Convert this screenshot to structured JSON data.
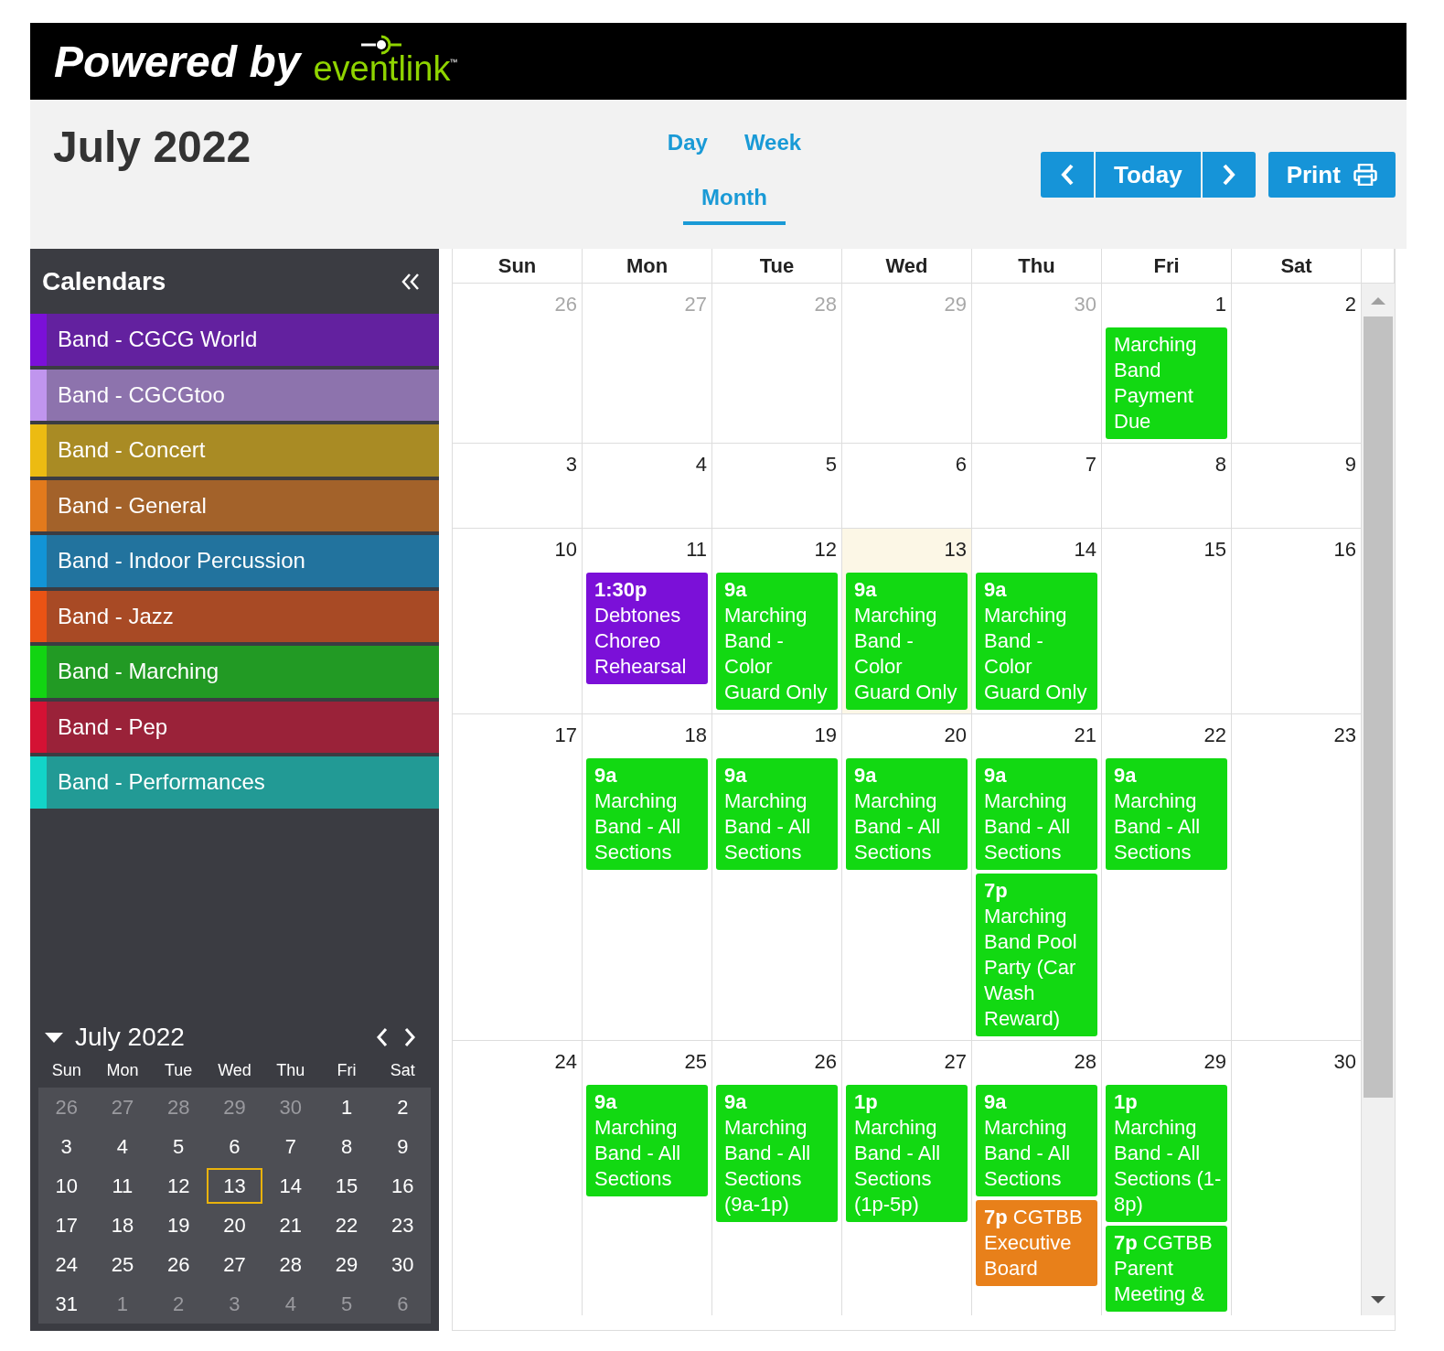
{
  "brand": {
    "prefix": "Powered by",
    "name": "eventlink",
    "trademark": "™"
  },
  "toolbar": {
    "title": "July 2022",
    "views": [
      {
        "label": "Day",
        "selected": false
      },
      {
        "label": "Week",
        "selected": false
      },
      {
        "label": "Month",
        "selected": true
      }
    ],
    "today_button": "Today",
    "print_button": "Print"
  },
  "sidebar": {
    "title": "Calendars",
    "calendars": [
      {
        "label": "Band - CGCG World",
        "color": "#7b10d8"
      },
      {
        "label": "Band - CGCGtoo",
        "color": "#c095ee"
      },
      {
        "label": "Band - Concert",
        "color": "#ecbb12"
      },
      {
        "label": "Band - General",
        "color": "#e27a1c"
      },
      {
        "label": "Band - Indoor Percussion",
        "color": "#1294d6"
      },
      {
        "label": "Band - Jazz",
        "color": "#ea5314"
      },
      {
        "label": "Band - Marching",
        "color": "#12d412"
      },
      {
        "label": "Band - Pep",
        "color": "#d41234"
      },
      {
        "label": "Band - Performances",
        "color": "#12d4c8"
      }
    ],
    "mini_calendar": {
      "title": "July 2022",
      "expanded": true,
      "weekdays": [
        "Sun",
        "Mon",
        "Tue",
        "Wed",
        "Thu",
        "Fri",
        "Sat"
      ],
      "weeks": [
        [
          {
            "day": "26",
            "other_month": true,
            "today": false
          },
          {
            "day": "27",
            "other_month": true,
            "today": false
          },
          {
            "day": "28",
            "other_month": true,
            "today": false
          },
          {
            "day": "29",
            "other_month": true,
            "today": false
          },
          {
            "day": "30",
            "other_month": true,
            "today": false
          },
          {
            "day": "1",
            "other_month": false,
            "today": false
          },
          {
            "day": "2",
            "other_month": false,
            "today": false
          }
        ],
        [
          {
            "day": "3",
            "other_month": false,
            "today": false
          },
          {
            "day": "4",
            "other_month": false,
            "today": false
          },
          {
            "day": "5",
            "other_month": false,
            "today": false
          },
          {
            "day": "6",
            "other_month": false,
            "today": false
          },
          {
            "day": "7",
            "other_month": false,
            "today": false
          },
          {
            "day": "8",
            "other_month": false,
            "today": false
          },
          {
            "day": "9",
            "other_month": false,
            "today": false
          }
        ],
        [
          {
            "day": "10",
            "other_month": false,
            "today": false
          },
          {
            "day": "11",
            "other_month": false,
            "today": false
          },
          {
            "day": "12",
            "other_month": false,
            "today": false
          },
          {
            "day": "13",
            "other_month": false,
            "today": true
          },
          {
            "day": "14",
            "other_month": false,
            "today": false
          },
          {
            "day": "15",
            "other_month": false,
            "today": false
          },
          {
            "day": "16",
            "other_month": false,
            "today": false
          }
        ],
        [
          {
            "day": "17",
            "other_month": false,
            "today": false
          },
          {
            "day": "18",
            "other_month": false,
            "today": false
          },
          {
            "day": "19",
            "other_month": false,
            "today": false
          },
          {
            "day": "20",
            "other_month": false,
            "today": false
          },
          {
            "day": "21",
            "other_month": false,
            "today": false
          },
          {
            "day": "22",
            "other_month": false,
            "today": false
          },
          {
            "day": "23",
            "other_month": false,
            "today": false
          }
        ],
        [
          {
            "day": "24",
            "other_month": false,
            "today": false
          },
          {
            "day": "25",
            "other_month": false,
            "today": false
          },
          {
            "day": "26",
            "other_month": false,
            "today": false
          },
          {
            "day": "27",
            "other_month": false,
            "today": false
          },
          {
            "day": "28",
            "other_month": false,
            "today": false
          },
          {
            "day": "29",
            "other_month": false,
            "today": false
          },
          {
            "day": "30",
            "other_month": false,
            "today": false
          }
        ],
        [
          {
            "day": "31",
            "other_month": false,
            "today": false
          },
          {
            "day": "1",
            "other_month": true,
            "today": false
          },
          {
            "day": "2",
            "other_month": true,
            "today": false
          },
          {
            "day": "3",
            "other_month": true,
            "today": false
          },
          {
            "day": "4",
            "other_month": true,
            "today": false
          },
          {
            "day": "5",
            "other_month": true,
            "today": false
          },
          {
            "day": "6",
            "other_month": true,
            "today": false
          }
        ]
      ]
    }
  },
  "month": {
    "weekdays": [
      "Sun",
      "Mon",
      "Tue",
      "Wed",
      "Thu",
      "Fri",
      "Sat"
    ],
    "weeks": [
      [
        {
          "day": "26",
          "other_month": true,
          "today": false
        },
        {
          "day": "27",
          "other_month": true,
          "today": false
        },
        {
          "day": "28",
          "other_month": true,
          "today": false
        },
        {
          "day": "29",
          "other_month": true,
          "today": false
        },
        {
          "day": "30",
          "other_month": true,
          "today": false
        },
        {
          "day": "1",
          "other_month": false,
          "today": false,
          "events": [
            {
              "kind": "block",
              "title": "Marching Band Payment Due",
              "color": "#12d912"
            }
          ]
        },
        {
          "day": "2",
          "other_month": false,
          "today": false
        }
      ],
      [
        {
          "day": "3",
          "other_month": false,
          "today": false
        },
        {
          "day": "4",
          "other_month": false,
          "today": false
        },
        {
          "day": "5",
          "other_month": false,
          "today": false
        },
        {
          "day": "6",
          "other_month": false,
          "today": false
        },
        {
          "day": "7",
          "other_month": false,
          "today": false
        },
        {
          "day": "8",
          "other_month": false,
          "today": false
        },
        {
          "day": "9",
          "other_month": false,
          "today": false
        }
      ],
      [
        {
          "day": "10",
          "other_month": false,
          "today": false
        },
        {
          "day": "11",
          "other_month": false,
          "today": false,
          "events": [
            {
              "kind": "block",
              "time": "1:30p",
              "title": "Debtones Choreo Rehearsal",
              "color": "#7b10d8"
            }
          ]
        },
        {
          "day": "12",
          "other_month": false,
          "today": false,
          "events": [
            {
              "kind": "block",
              "time": "9a",
              "title": "Marching Band - Color Guard Only",
              "color": "#12d912"
            }
          ]
        },
        {
          "day": "13",
          "other_month": false,
          "today": true,
          "events": [
            {
              "kind": "block",
              "time": "9a",
              "title": "Marching Band - Color Guard Only",
              "color": "#12d912"
            }
          ]
        },
        {
          "day": "14",
          "other_month": false,
          "today": false,
          "events": [
            {
              "kind": "block",
              "time": "9a",
              "title": "Marching Band - Color Guard Only",
              "color": "#12d912"
            }
          ]
        },
        {
          "day": "15",
          "other_month": false,
          "today": false
        },
        {
          "day": "16",
          "other_month": false,
          "today": false
        }
      ],
      [
        {
          "day": "17",
          "other_month": false,
          "today": false
        },
        {
          "day": "18",
          "other_month": false,
          "today": false,
          "events": [
            {
              "kind": "block",
              "time": "9a",
              "title": "Marching Band - All Sections",
              "color": "#12d912"
            }
          ]
        },
        {
          "day": "19",
          "other_month": false,
          "today": false,
          "events": [
            {
              "kind": "block",
              "time": "9a",
              "title": "Marching Band - All Sections",
              "color": "#12d912"
            }
          ]
        },
        {
          "day": "20",
          "other_month": false,
          "today": false,
          "events": [
            {
              "kind": "block",
              "time": "9a",
              "title": "Marching Band - All Sections",
              "color": "#12d912"
            }
          ]
        },
        {
          "day": "21",
          "other_month": false,
          "today": false,
          "events": [
            {
              "kind": "block",
              "time": "9a",
              "title": "Marching Band - All Sections",
              "color": "#12d912"
            },
            {
              "kind": "block",
              "time": "7p",
              "title": "Marching Band Pool Party (Car Wash Reward)",
              "color": "#12d912"
            }
          ]
        },
        {
          "day": "22",
          "other_month": false,
          "today": false,
          "events": [
            {
              "kind": "block",
              "time": "9a",
              "title": "Marching Band - All Sections",
              "color": "#12d912"
            }
          ]
        },
        {
          "day": "23",
          "other_month": false,
          "today": false
        }
      ],
      [
        {
          "day": "24",
          "other_month": false,
          "today": false
        },
        {
          "day": "25",
          "other_month": false,
          "today": false,
          "events": [
            {
              "kind": "block",
              "time": "9a",
              "title": "Marching Band - All Sections",
              "color": "#12d912"
            }
          ]
        },
        {
          "day": "26",
          "other_month": false,
          "today": false,
          "events": [
            {
              "kind": "block",
              "time": "9a",
              "title": "Marching Band - All Sections (9a-1p)",
              "color": "#12d912"
            }
          ]
        },
        {
          "day": "27",
          "other_month": false,
          "today": false,
          "events": [
            {
              "kind": "block",
              "time": "1p",
              "title": "Marching Band - All Sections (1p-5p)",
              "color": "#12d912"
            }
          ]
        },
        {
          "day": "28",
          "other_month": false,
          "today": false,
          "events": [
            {
              "kind": "block",
              "time": "9a",
              "title": "Marching Band - All Sections",
              "color": "#12d912"
            },
            {
              "kind": "inline",
              "time": "7p",
              "title": "CGTBB Executive Board",
              "color": "#e8801a"
            }
          ]
        },
        {
          "day": "29",
          "other_month": false,
          "today": false,
          "events": [
            {
              "kind": "block",
              "time": "1p",
              "title": "Marching Band - All Sections (1-8p)",
              "color": "#12d912"
            },
            {
              "kind": "inline",
              "time": "7p",
              "title": "CGTBB Parent Meeting &",
              "color": "#12d912"
            }
          ]
        },
        {
          "day": "30",
          "other_month": false,
          "today": false
        }
      ]
    ]
  }
}
